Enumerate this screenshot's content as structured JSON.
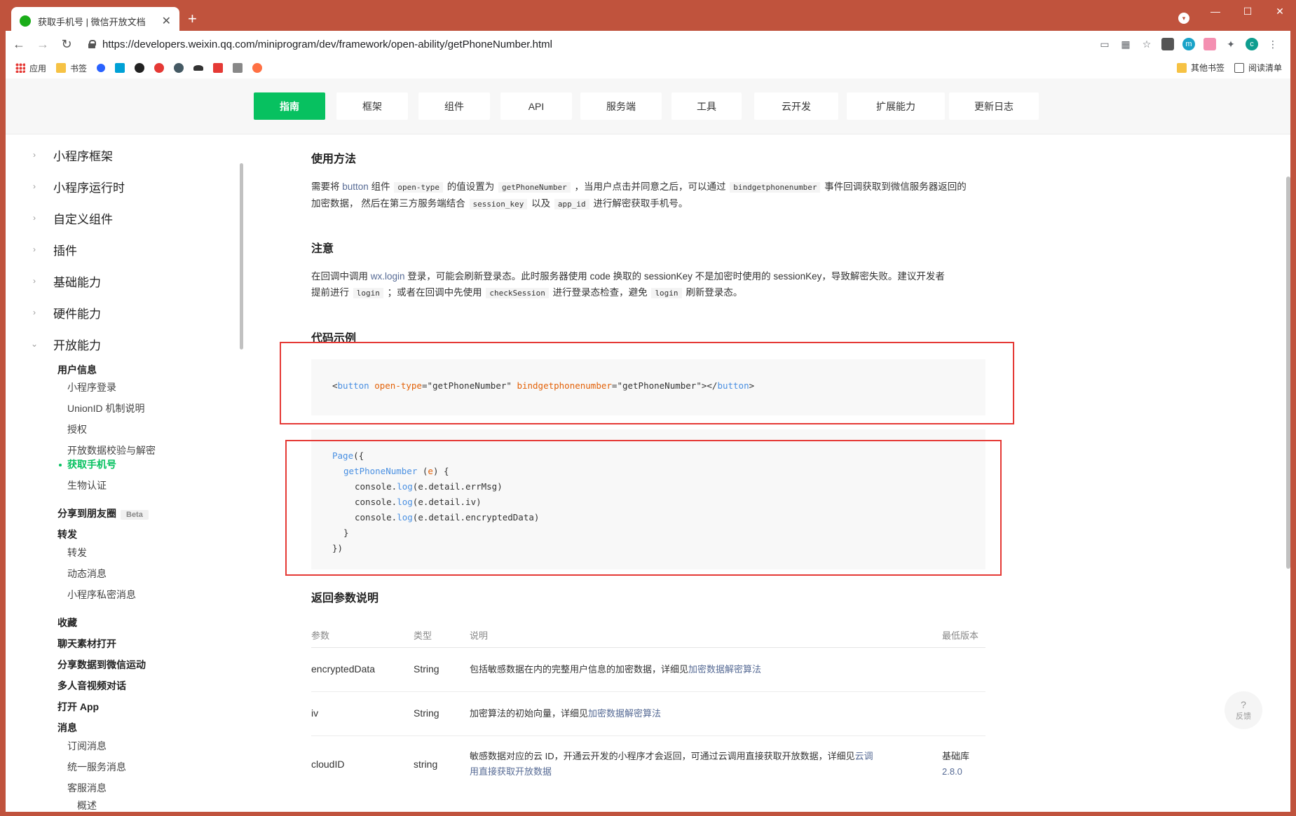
{
  "browser": {
    "tab_title": "获取手机号 | 微信开放文档",
    "tab_close": "✕",
    "new_tab": "+",
    "url": "https://developers.weixin.qq.com/miniprogram/dev/framework/open-ability/getPhoneNumber.html",
    "window_controls": [
      "—",
      "☐",
      "✕"
    ],
    "profile_initial": "c",
    "ext_initial": "m"
  },
  "bookmarks": {
    "apps": "应用",
    "bookmarks": "书签",
    "other_bookmarks": "其他书签",
    "reading_list": "阅读清单"
  },
  "topnav": {
    "tabs": [
      "指南",
      "框架",
      "组件",
      "API",
      "服务端",
      "工具",
      "云开发",
      "扩展能力",
      "更新日志"
    ]
  },
  "sidebar": {
    "top": [
      "小程序框架",
      "小程序运行时",
      "自定义组件",
      "插件",
      "基础能力",
      "硬件能力",
      "开放能力"
    ],
    "chevron_collapsed": "›",
    "chevron_expanded": "⌄",
    "user_info": "用户信息",
    "user_info_items": [
      "小程序登录",
      "UnionID 机制说明",
      "授权",
      "开放数据校验与解密",
      "获取手机号",
      "生物认证"
    ],
    "share_moments": "分享到朋友圈",
    "beta": "Beta",
    "forward": "转发",
    "forward_items": [
      "转发",
      "动态消息",
      "小程序私密消息"
    ],
    "more": [
      "收藏",
      "聊天素材打开",
      "分享数据到微信运动",
      "多人音视频对话",
      "打开 App",
      "消息"
    ],
    "message_items": [
      "订阅消息",
      "统一服务消息",
      "客服消息"
    ],
    "overview": "概述"
  },
  "content": {
    "usage_title": "使用方法",
    "usage_p1_a": "需要将",
    "usage_p1_button": "button",
    "usage_p1_b": "组件",
    "usage_p1_code1": "open-type",
    "usage_p1_c": "的值设置为",
    "usage_p1_code2": "getPhoneNumber",
    "usage_p1_d": "，当用户点击并同意之后，可以通过",
    "usage_p1_code3": "bindgetphonenumber",
    "usage_p1_e": "事件回调获取到微信服务器返回的",
    "usage_p2_a": "加密数据， 然后在第三方服务端结合",
    "usage_p2_code1": "session_key",
    "usage_p2_b": "以及",
    "usage_p2_code2": "app_id",
    "usage_p2_c": "进行解密获取手机号。",
    "note_title": "注意",
    "note_p1_a": "在回调中调用",
    "note_p1_link": "wx.login",
    "note_p1_b": "登录，可能会刷新登录态。此时服务器使用 code 换取的 sessionKey 不是加密时使用的 sessionKey，导致解密失败。建议开发者",
    "note_p2_a": "提前进行",
    "note_p2_code1": "login",
    "note_p2_b": "；或者在回调中先使用",
    "note_p2_code2": "checkSession",
    "note_p2_c": "进行登录态检查，避免",
    "note_p2_code3": "login",
    "note_p2_d": "刷新登录态。",
    "example_title": "代码示例",
    "code1": {
      "lt": "<",
      "tag": "button",
      "attr1": "open-type",
      "eq1": "=",
      "val1": "\"getPhoneNumber\"",
      "attr2": "bindgetphonenumber",
      "eq2": "=",
      "val2": "\"getPhoneNumber\"",
      "close_open": "></",
      "close_tag": "button",
      "gt": ">"
    },
    "code2": {
      "page": "Page",
      "page_paren": "({",
      "fn": "getPhoneNumber",
      "fn_args_open": " (",
      "fn_arg": "e",
      "fn_args_close": ") {",
      "console": "console.",
      "log": "log",
      "arg1": "(e.detail.errMsg)",
      "arg2": "(e.detail.iv)",
      "arg3": "(e.detail.encryptedData)",
      "close1": "}",
      "close2": "})"
    },
    "return_title": "返回参数说明",
    "table": {
      "headers": [
        "参数",
        "类型",
        "说明",
        "最低版本"
      ],
      "rows": [
        {
          "param": "encryptedData",
          "type": "String",
          "desc": "包括敏感数据在内的完整用户信息的加密数据，详细见",
          "link": "加密数据解密算法",
          "version": ""
        },
        {
          "param": "iv",
          "type": "String",
          "desc": "加密算法的初始向量，详细见",
          "link": "加密数据解密算法",
          "version": ""
        },
        {
          "param": "cloudID",
          "type": "string",
          "desc": "敏感数据对应的云 ID，开通云开发的小程序才会返回，可通过云调用直接获取开放数据，详细见",
          "link1": "云调",
          "link2": "用直接获取开放数据",
          "version_label": "基础库",
          "version": "2.8.0"
        }
      ]
    }
  },
  "feedback": {
    "icon": "?",
    "label": "反馈"
  },
  "colors": {
    "brand": "#07c160",
    "chrome": "#c0533d",
    "link": "#576b95",
    "highlight": "#e53935"
  }
}
